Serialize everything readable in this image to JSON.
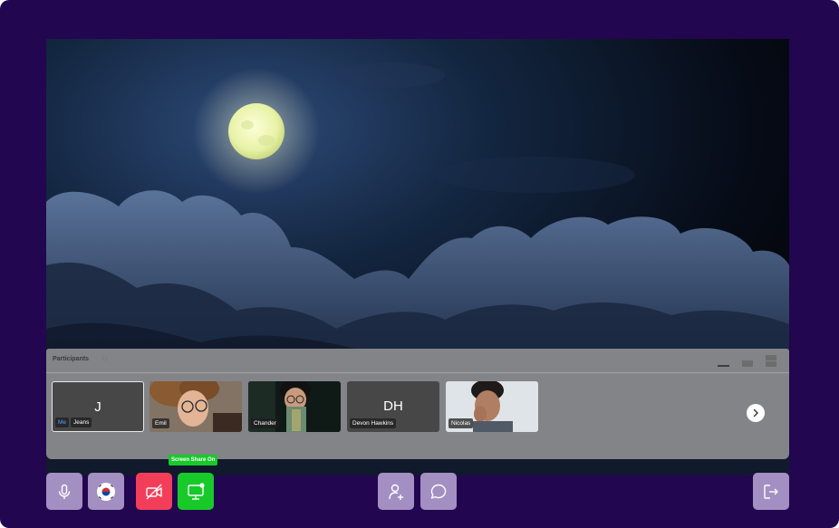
{
  "colors": {
    "app_background": "#22064f",
    "control_button": "#a38fc2",
    "camera_off": "#f33e5a",
    "screen_share_on": "#18c92a"
  },
  "participants_panel": {
    "title": "Participants",
    "pin_icon": "pin-icon",
    "layout_icons": [
      "minimize-layout-icon",
      "grid-layout-icon",
      "stacked-layout-icon"
    ],
    "tiles": [
      {
        "initials": "J",
        "me_tag": "Me",
        "name": "Jeans",
        "selected": true,
        "has_video": false
      },
      {
        "initials": "",
        "name": "Emil",
        "has_video": true
      },
      {
        "initials": "",
        "name": "Chander",
        "has_video": true
      },
      {
        "initials": "DH",
        "name": "Devon Hawkins",
        "has_video": false
      },
      {
        "initials": "",
        "name": "Nicolas",
        "has_video": true
      }
    ],
    "next_icon": "chevron-right-icon"
  },
  "controls": {
    "mic_icon": "microphone-icon",
    "language_icon": "korea-flag-icon",
    "camera_icon": "video-off-icon",
    "screen_share_icon": "screen-share-icon",
    "screen_share_tooltip": "Screen Share On",
    "add_participant_icon": "add-user-icon",
    "chat_icon": "chat-icon",
    "leave_icon": "leave-icon"
  }
}
